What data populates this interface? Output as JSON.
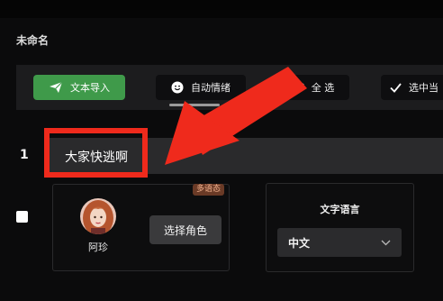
{
  "page": {
    "title": "未命名"
  },
  "toolbar": {
    "import_label": "文本导入",
    "emotion_label": "自动情绪",
    "select_all_label": "全 选",
    "select_middle_label": "选中当"
  },
  "row": {
    "number": "1",
    "text": "大家快逃啊"
  },
  "character": {
    "badge": "多语态",
    "name": "阿珍",
    "choose_label": "选择角色"
  },
  "language": {
    "label": "文字语言",
    "selected": "中文"
  },
  "colors": {
    "accent_green": "#3f9a4a",
    "highlight_red": "#ef2a1c"
  }
}
